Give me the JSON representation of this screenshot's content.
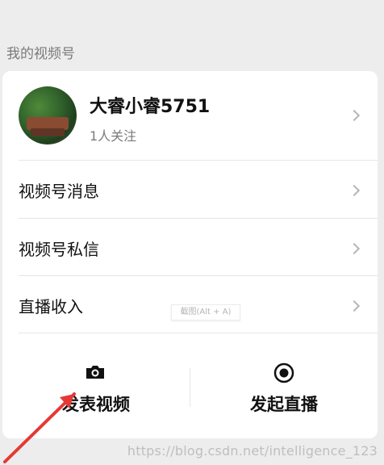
{
  "section_title": "我的视频号",
  "profile": {
    "name": "大睿小睿5751",
    "followers": "1人关注"
  },
  "menu_items": [
    {
      "label": "视频号消息"
    },
    {
      "label": "视频号私信"
    },
    {
      "label": "直播收入"
    }
  ],
  "screenshot_tooltip": "截图(Alt + A)",
  "actions": [
    {
      "label": "发表视频",
      "icon": "camera-icon"
    },
    {
      "label": "发起直播",
      "icon": "record-icon"
    }
  ],
  "watermark": "https://blog.csdn.net/intelligence_123",
  "colors": {
    "background": "#ededed",
    "card": "#ffffff",
    "text_primary": "#111111",
    "text_secondary": "#7a7a7a",
    "arrow": "#e53935"
  }
}
